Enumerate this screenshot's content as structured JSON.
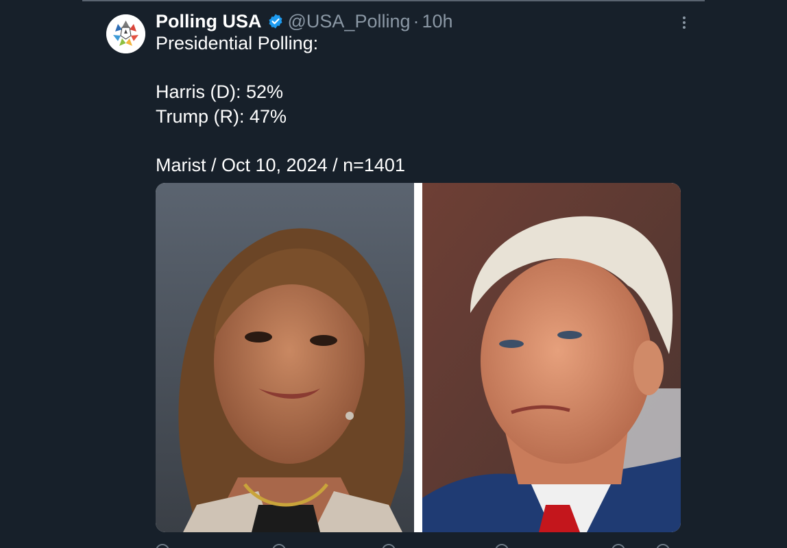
{
  "tweet": {
    "display_name": "Polling USA",
    "verified": true,
    "handle": "@USA_Polling",
    "separator": "·",
    "time": "10h",
    "text_lines": [
      "Presidential Polling:",
      "",
      "Harris (D): 52%",
      "Trump (R): 47%",
      "",
      "Marist / Oct 10, 2024 / n=1401"
    ],
    "media": [
      {
        "icon": "photo-left-portrait"
      },
      {
        "icon": "photo-right-portrait"
      }
    ]
  },
  "colors": {
    "background": "#17202a",
    "text": "#ffffff",
    "muted": "#8b98a5",
    "verified": "#1d9bf0"
  }
}
